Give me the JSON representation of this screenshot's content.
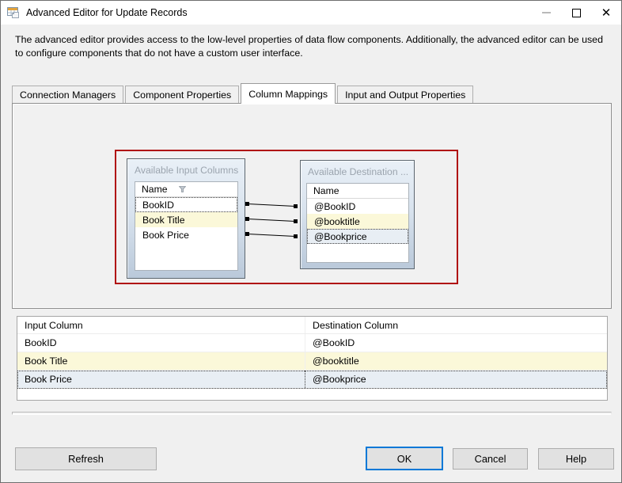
{
  "window": {
    "title": "Advanced Editor for Update Records",
    "controls": {
      "close_glyph": "✕"
    }
  },
  "description": "The advanced editor provides access to the low-level properties of data flow components. Additionally, the advanced editor can be used to configure components that do not have a custom user interface.",
  "tabs": [
    {
      "label": "Connection Managers"
    },
    {
      "label": "Component Properties"
    },
    {
      "label": "Column Mappings"
    },
    {
      "label": "Input and Output Properties"
    }
  ],
  "active_tab": "Column Mappings",
  "diagram": {
    "input_table": {
      "title": "Available Input Columns",
      "header": "Name",
      "rows": [
        "BookID",
        "Book Title",
        "Book Price"
      ]
    },
    "destination_table": {
      "title": "Available Destination ...",
      "header": "Name",
      "rows": [
        "@BookID",
        "@booktitle",
        "@Bookprice"
      ]
    },
    "connections": [
      {
        "from": "BookID",
        "to": "@BookID"
      },
      {
        "from": "Book Title",
        "to": "@booktitle"
      },
      {
        "from": "Book Price",
        "to": "@Bookprice"
      }
    ]
  },
  "mapping_table": {
    "columns": [
      "Input Column",
      "Destination Column"
    ],
    "rows": [
      {
        "input": "BookID",
        "destination": "@BookID",
        "highlight": "none"
      },
      {
        "input": "Book Title",
        "destination": "@booktitle",
        "highlight": "yellow"
      },
      {
        "input": "Book Price",
        "destination": "@Bookprice",
        "highlight": "selected"
      }
    ]
  },
  "buttons": {
    "refresh": "Refresh",
    "ok": "OK",
    "cancel": "Cancel",
    "help": "Help"
  },
  "colors": {
    "accent_red": "#b01010",
    "highlight_yellow": "#fbf8d9",
    "selected_row": "#e8eef4",
    "focus_blue": "#0078d7"
  }
}
